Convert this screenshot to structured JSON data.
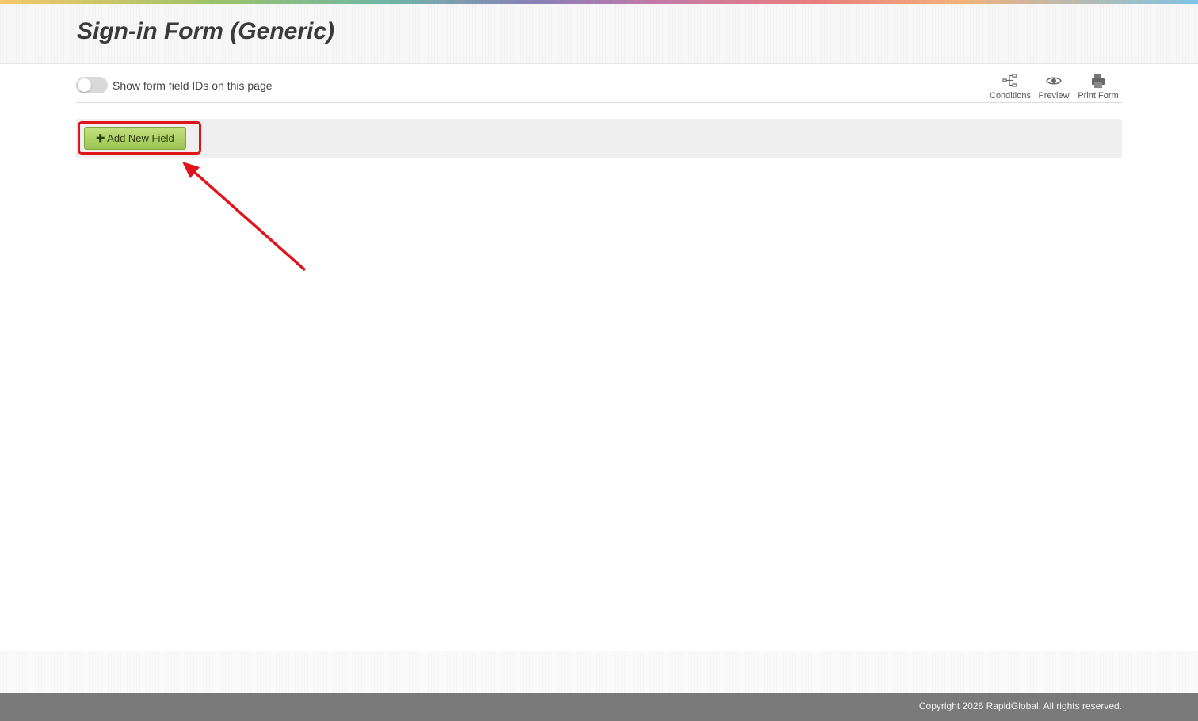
{
  "header": {
    "title": "Sign-in Form (Generic)"
  },
  "toolbar": {
    "toggle_label": "Show form field IDs on this page",
    "toggle_on": false,
    "tools": [
      {
        "label": "Conditions",
        "icon": "conditions-icon"
      },
      {
        "label": "Preview",
        "icon": "eye-icon"
      },
      {
        "label": "Print Form",
        "icon": "printer-icon"
      }
    ]
  },
  "fields": {
    "add_button_label": "Add New Field",
    "add_button_icon": "plus-icon"
  },
  "annotation": {
    "color": "#e0141b",
    "target": "add-new-field-button"
  },
  "footer": {
    "copyright": "Copyright 2026 RapidGlobal. All rights reserved."
  },
  "colors": {
    "button_green": "#9dc552",
    "footer_gray": "#7a7a7a",
    "title_text": "#3a3a3a"
  }
}
